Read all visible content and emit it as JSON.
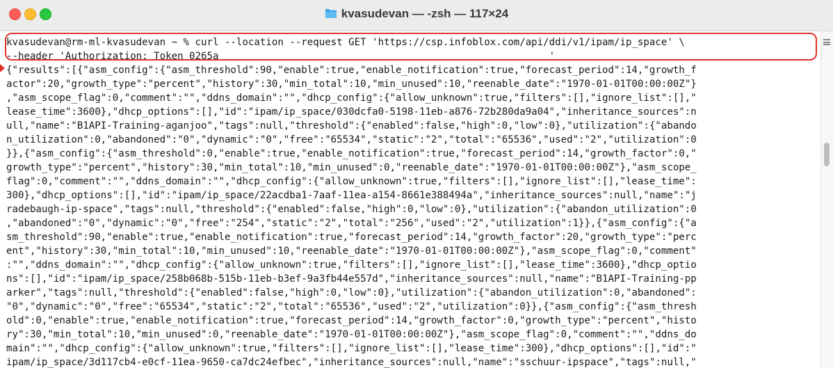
{
  "window": {
    "title": "kvasudevan — -zsh — 117×24"
  },
  "terminal": {
    "lines": [
      "kvasudevan@rm-ml-kvasudevan ~ % curl --location --request GET 'https://csp.infoblox.com/api/ddi/v1/ipam/ip_space' \\",
      "--header 'Authorization: Token 0265a                                                        '",
      "{\"results\":[{\"asm_config\":{\"asm_threshold\":90,\"enable\":true,\"enable_notification\":true,\"forecast_period\":14,\"growth_f",
      "actor\":20,\"growth_type\":\"percent\",\"history\":30,\"min_total\":10,\"min_unused\":10,\"reenable_date\":\"1970-01-01T00:00:00Z\"}",
      ",\"asm_scope_flag\":0,\"comment\":\"\",\"ddns_domain\":\"\",\"dhcp_config\":{\"allow_unknown\":true,\"filters\":[],\"ignore_list\":[],\"",
      "lease_time\":3600},\"dhcp_options\":[],\"id\":\"ipam/ip_space/030dcfa0-5198-11eb-a876-72b280da9a04\",\"inheritance_sources\":n",
      "ull,\"name\":\"B1API-Training-aganjoo\",\"tags\":null,\"threshold\":{\"enabled\":false,\"high\":0,\"low\":0},\"utilization\":{\"abando",
      "n_utilization\":0,\"abandoned\":\"0\",\"dynamic\":\"0\",\"free\":\"65534\",\"static\":\"2\",\"total\":\"65536\",\"used\":\"2\",\"utilization\":0",
      "}},{\"asm_config\":{\"asm_threshold\":0,\"enable\":true,\"enable_notification\":true,\"forecast_period\":14,\"growth_factor\":0,\"",
      "growth_type\":\"percent\",\"history\":30,\"min_total\":10,\"min_unused\":0,\"reenable_date\":\"1970-01-01T00:00:00Z\"},\"asm_scope_",
      "flag\":0,\"comment\":\"\",\"ddns_domain\":\"\",\"dhcp_config\":{\"allow_unknown\":true,\"filters\":[],\"ignore_list\":[],\"lease_time\":",
      "300},\"dhcp_options\":[],\"id\":\"ipam/ip_space/22acdba1-7aaf-11ea-a154-8661e388494a\",\"inheritance_sources\":null,\"name\":\"j",
      "radebaugh-ip-space\",\"tags\":null,\"threshold\":{\"enabled\":false,\"high\":0,\"low\":0},\"utilization\":{\"abandon_utilization\":0",
      ",\"abandoned\":\"0\",\"dynamic\":\"0\",\"free\":\"254\",\"static\":\"2\",\"total\":\"256\",\"used\":\"2\",\"utilization\":1}},{\"asm_config\":{\"a",
      "sm_threshold\":90,\"enable\":true,\"enable_notification\":true,\"forecast_period\":14,\"growth_factor\":20,\"growth_type\":\"perc",
      "ent\",\"history\":30,\"min_total\":10,\"min_unused\":10,\"reenable_date\":\"1970-01-01T00:00:00Z\"},\"asm_scope_flag\":0,\"comment\"",
      ":\"\",\"ddns_domain\":\"\",\"dhcp_config\":{\"allow_unknown\":true,\"filters\":[],\"ignore_list\":[],\"lease_time\":3600},\"dhcp_optio",
      "ns\":[],\"id\":\"ipam/ip_space/258b068b-515b-11eb-b3ef-9a3fb44e557d\",\"inheritance_sources\":null,\"name\":\"B1API-Training-pp",
      "arker\",\"tags\":null,\"threshold\":{\"enabled\":false,\"high\":0,\"low\":0},\"utilization\":{\"abandon_utilization\":0,\"abandoned\":",
      "\"0\",\"dynamic\":\"0\",\"free\":\"65534\",\"static\":\"2\",\"total\":\"65536\",\"used\":\"2\",\"utilization\":0}},{\"asm_config\":{\"asm_thresh",
      "old\":0,\"enable\":true,\"enable_notification\":true,\"forecast_period\":14,\"growth_factor\":0,\"growth_type\":\"percent\",\"histo",
      "ry\":30,\"min_total\":10,\"min_unused\":0,\"reenable_date\":\"1970-01-01T00:00:00Z\"},\"asm_scope_flag\":0,\"comment\":\"\",\"ddns_do",
      "main\":\"\",\"dhcp_config\":{\"allow_unknown\":true,\"filters\":[],\"ignore_list\":[],\"lease_time\":300},\"dhcp_options\":[],\"id\":\"",
      "ipam/ip_space/3d117cb4-e0cf-11ea-9650-ca7dc24efbec\",\"inheritance_sources\":null,\"name\":\"sschuur-ipspace\",\"tags\":null,\""
    ]
  },
  "colors": {
    "highlight": "#e0322b",
    "text": "#1a1a1a"
  },
  "icons": {
    "folder": "folder-icon",
    "scroll_menu": "hamburger-icon"
  }
}
